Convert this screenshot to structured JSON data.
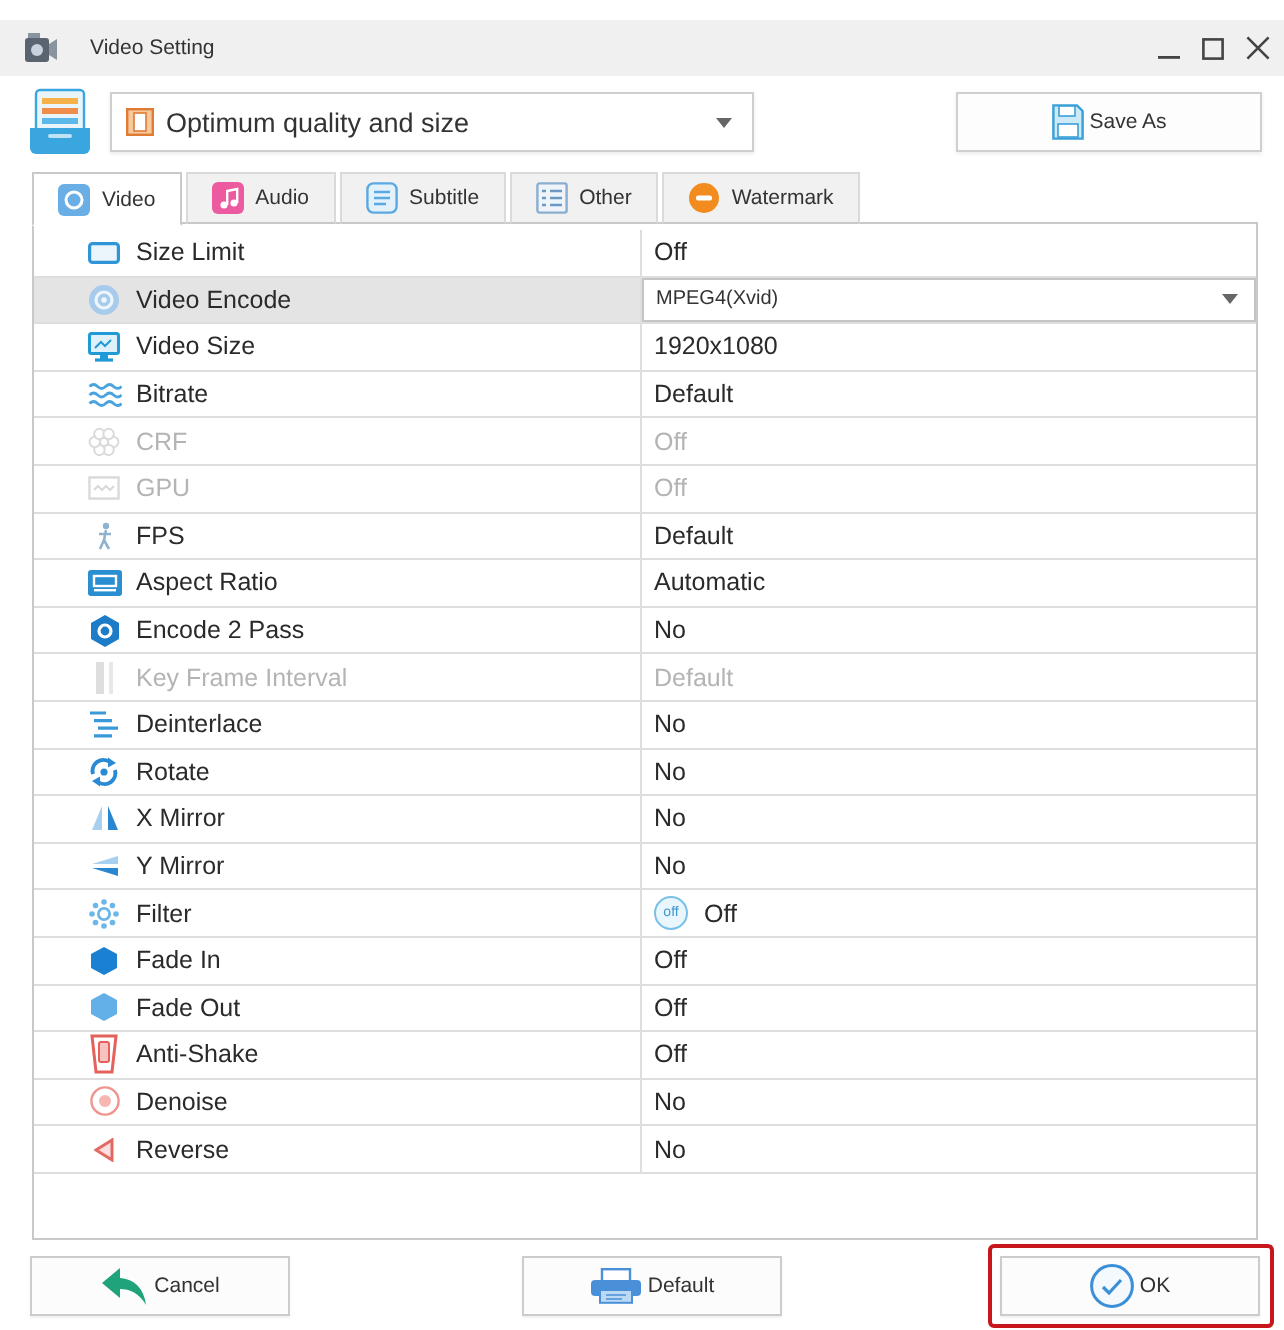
{
  "window": {
    "title": "Video Setting"
  },
  "profile": {
    "value": "Optimum quality and size"
  },
  "save_button": {
    "label": "Save As"
  },
  "tabs": [
    {
      "label": "Video",
      "selected": true
    },
    {
      "label": "Audio",
      "selected": false
    },
    {
      "label": "Subtitle",
      "selected": false
    },
    {
      "label": "Other",
      "selected": false
    },
    {
      "label": "Watermark",
      "selected": false
    }
  ],
  "settings": [
    {
      "name": "Size Limit",
      "value": "Off",
      "kind": "text",
      "disabled": false,
      "selected": false
    },
    {
      "name": "Video Encode",
      "value": "MPEG4(Xvid)",
      "kind": "dropdown",
      "disabled": false,
      "selected": true
    },
    {
      "name": "Video Size",
      "value": "1920x1080",
      "kind": "text",
      "disabled": false,
      "selected": false
    },
    {
      "name": "Bitrate",
      "value": "Default",
      "kind": "text",
      "disabled": false,
      "selected": false
    },
    {
      "name": "CRF",
      "value": "Off",
      "kind": "text",
      "disabled": true,
      "selected": false
    },
    {
      "name": "GPU",
      "value": "Off",
      "kind": "text",
      "disabled": true,
      "selected": false
    },
    {
      "name": "FPS",
      "value": "Default",
      "kind": "text",
      "disabled": false,
      "selected": false
    },
    {
      "name": "Aspect Ratio",
      "value": "Automatic",
      "kind": "text",
      "disabled": false,
      "selected": false
    },
    {
      "name": "Encode 2 Pass",
      "value": "No",
      "kind": "text",
      "disabled": false,
      "selected": false
    },
    {
      "name": "Key Frame Interval",
      "value": "Default",
      "kind": "text",
      "disabled": true,
      "selected": false
    },
    {
      "name": "Deinterlace",
      "value": "No",
      "kind": "text",
      "disabled": false,
      "selected": false
    },
    {
      "name": "Rotate",
      "value": "No",
      "kind": "text",
      "disabled": false,
      "selected": false
    },
    {
      "name": "X Mirror",
      "value": "No",
      "kind": "text",
      "disabled": false,
      "selected": false
    },
    {
      "name": "Y Mirror",
      "value": "No",
      "kind": "text",
      "disabled": false,
      "selected": false
    },
    {
      "name": "Filter",
      "value": "Off",
      "kind": "toggle",
      "badge": "off",
      "disabled": false,
      "selected": false
    },
    {
      "name": "Fade In",
      "value": "Off",
      "kind": "text",
      "disabled": false,
      "selected": false
    },
    {
      "name": "Fade Out",
      "value": "Off",
      "kind": "text",
      "disabled": false,
      "selected": false
    },
    {
      "name": "Anti-Shake",
      "value": "Off",
      "kind": "text",
      "disabled": false,
      "selected": false
    },
    {
      "name": "Denoise",
      "value": "No",
      "kind": "text",
      "disabled": false,
      "selected": false
    },
    {
      "name": "Reverse",
      "value": "No",
      "kind": "text",
      "disabled": false,
      "selected": false
    }
  ],
  "buttons": [
    {
      "label": "Cancel",
      "highlighted": false
    },
    {
      "label": "Default",
      "highlighted": false
    },
    {
      "label": "OK",
      "highlighted": true
    }
  ]
}
